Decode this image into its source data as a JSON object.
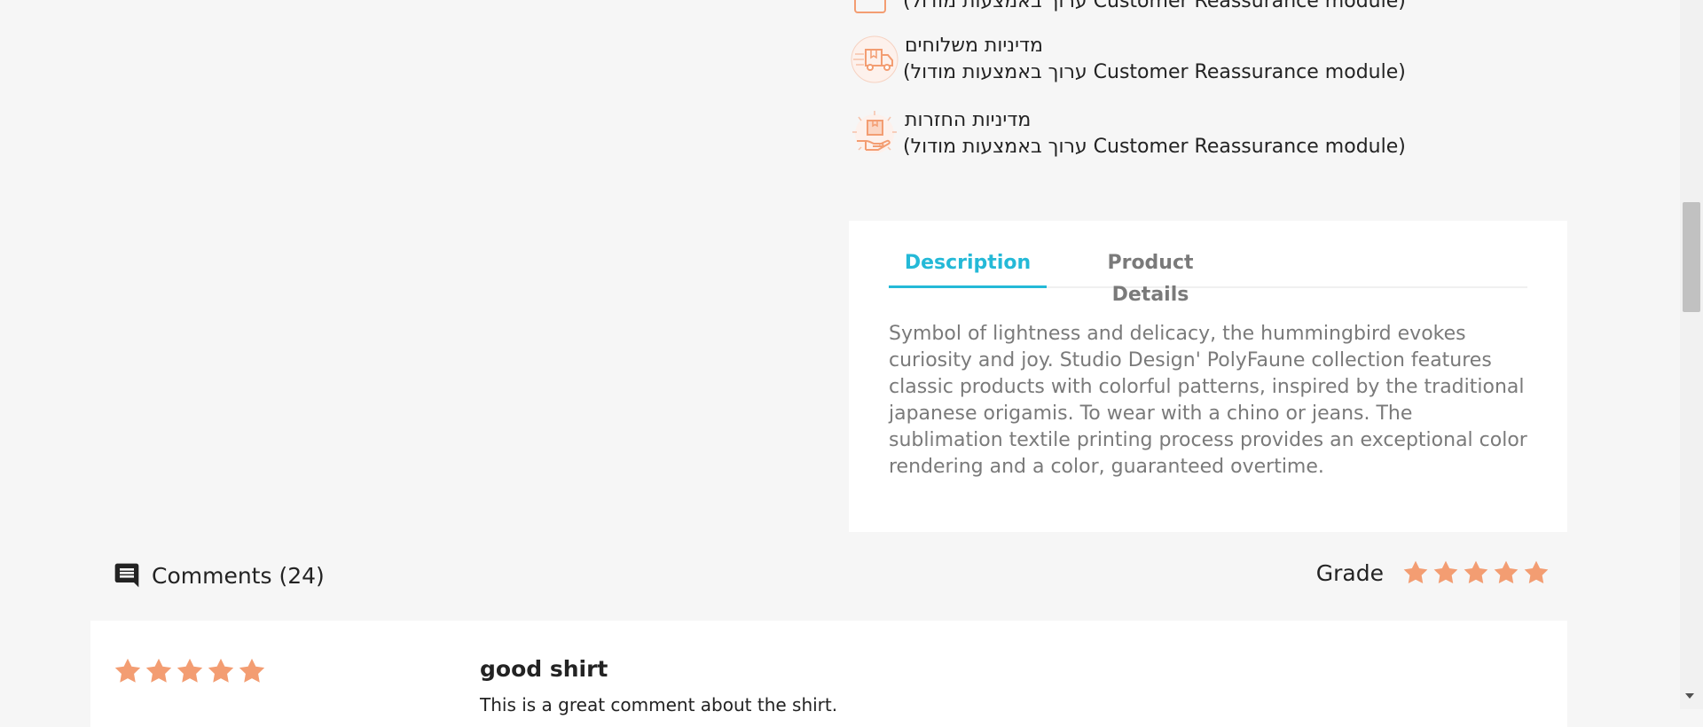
{
  "reassurance": {
    "items": [
      {
        "title": "",
        "desc": "(ערוך באמצעות מודול Customer Reassurance module)",
        "icon": "security-icon"
      },
      {
        "title": "מדיניות משלוחים",
        "desc": "(ערוך באמצעות מודול Customer Reassurance module)",
        "icon": "delivery-truck-icon"
      },
      {
        "title": "מדיניות החזרות",
        "desc": "(ערוך באמצעות מודול Customer Reassurance module)",
        "icon": "return-package-icon"
      }
    ]
  },
  "tabs": {
    "items": [
      {
        "label": "Description",
        "active": true
      },
      {
        "label": "Product Details",
        "active": false
      }
    ],
    "description": "Symbol of lightness and delicacy, the hummingbird evokes curiosity and joy. Studio Design' PolyFaune collection features classic products with colorful patterns, inspired by the traditional japanese origamis. To wear with a chino or jeans. The sublimation textile printing process provides an exceptional color rendering and a color, guaranteed overtime."
  },
  "comments": {
    "title": "Comments (24)",
    "icon": "comment-icon",
    "grade_label": "Grade",
    "grade_value": 5,
    "grade_max": 5
  },
  "review": {
    "rating": 5,
    "title": "good shirt",
    "body": "This is a great comment about the shirt."
  },
  "colors": {
    "accent": "#24b9d7",
    "star": "#f39d72",
    "icon": "#f39d72",
    "card": "#ffffff",
    "page": "#f6f6f6"
  }
}
